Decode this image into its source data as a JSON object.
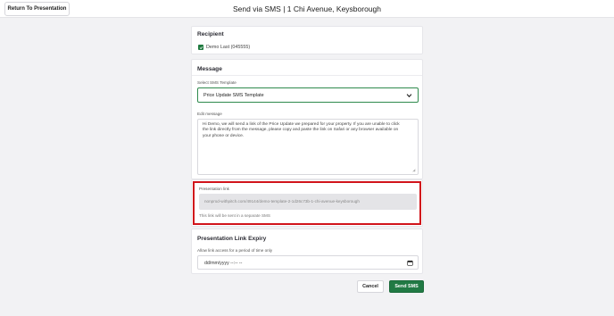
{
  "header": {
    "back_button": "Return To Presentation",
    "title": "Send via SMS | 1 Chi Avenue, Keysborough"
  },
  "recipient": {
    "title": "Recipient",
    "name": "Demo Last (045555)",
    "checked": true
  },
  "message": {
    "title": "Message",
    "template_label": "Select SMS Template",
    "template_value": "Price Update SMS Template",
    "edit_label": "Edit message",
    "body_line1": "Hi Demo, we will send a link of the Price Update we prepared for your property. If you are unable to click",
    "body_line2": "the link directly from the message, please copy and paste the link on Safari or any browser available on",
    "body_line3": "your phone or device."
  },
  "presentation_link": {
    "label": "Presentation link",
    "url": "nonprod-withpitch.com/49144/demo-template-2-1d26c73b-1-chi-avenue-keysborough",
    "note": "This link will be sent in a separate SMS"
  },
  "expiry": {
    "title": "Presentation Link Expiry",
    "label": "Allow link access for a period of time only",
    "placeholder": "dd/mm/yyyy --:-- --"
  },
  "actions": {
    "cancel": "Cancel",
    "send": "Send SMS"
  },
  "colors": {
    "accent_green": "#217a44",
    "highlight_red": "#d1141b"
  }
}
